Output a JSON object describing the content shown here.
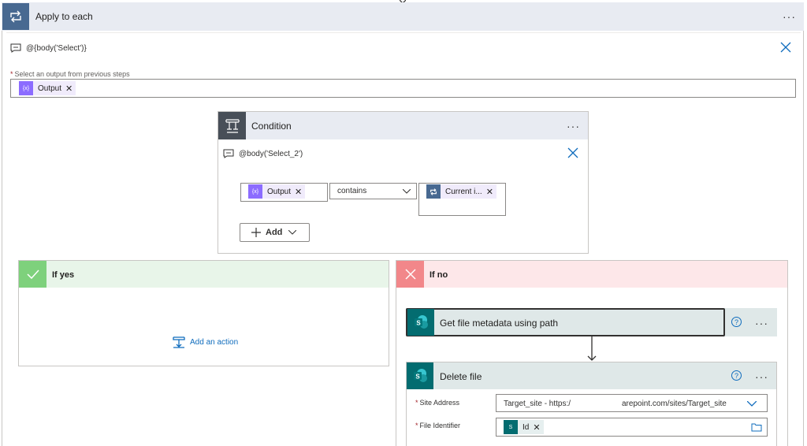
{
  "apply_to_each": {
    "title": "Apply to each",
    "expression": "@{body('Select')}",
    "output_label": "Select an output from previous steps",
    "output_token": "Output",
    "more": "···"
  },
  "condition": {
    "title": "Condition",
    "expression": "@body('Select_2')",
    "left_token": "Output",
    "operator": "contains",
    "right_token": "Current i...",
    "add_label": "Add",
    "more": "···"
  },
  "if_yes": {
    "title": "If yes",
    "add_action_label": "Add an action"
  },
  "if_no": {
    "title": "If no",
    "step1": {
      "title": "Get file metadata using path",
      "more": "···"
    },
    "step2": {
      "title": "Delete file",
      "more": "···",
      "site_address_label": "Site Address",
      "site_address_value_left": "Target_site - https:/",
      "site_address_value_right": "arepoint.com/sites/Target_site",
      "file_identifier_label": "File Identifier",
      "file_identifier_token": "Id"
    }
  },
  "icons": {
    "loop": "loop-icon",
    "condition": "condition-icon",
    "comment": "comment-icon",
    "close": "close-icon",
    "check": "check-icon",
    "x": "x-icon",
    "sharepoint": "sharepoint-icon",
    "help": "help-icon",
    "folder": "folder-icon",
    "chevron": "chevron-down-icon",
    "plus": "plus-icon"
  },
  "colors": {
    "loop_header": "#e8ebf2",
    "loop_icon_bg": "#486991",
    "condition_icon_bg": "#484f58",
    "variable_token": "#8c6cff",
    "yes_header": "#e8f5e9",
    "yes_icon": "#7ed17c",
    "no_header": "#fde7e9",
    "no_icon": "#f2878a",
    "sharepoint": "#036c70",
    "link": "#0f6cbd"
  }
}
